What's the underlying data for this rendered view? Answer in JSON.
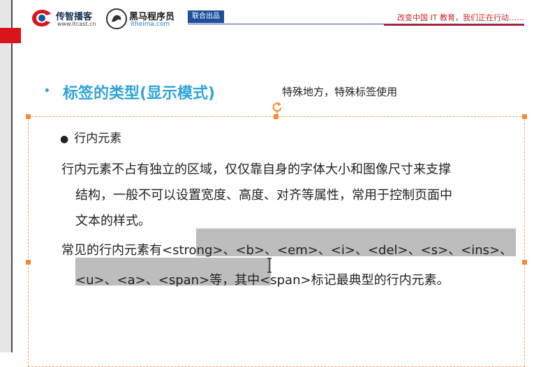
{
  "header": {
    "brand1": {
      "name": "传智播客",
      "url": "www.itcast.cn"
    },
    "brand2": {
      "name": "黑马程序员",
      "url": "itheima.com"
    },
    "joint_badge": "联合出品",
    "slogan": "改变中国 IT 教育，我们正在行动……"
  },
  "slide": {
    "title": "标签的类型(显示模式)",
    "subtitle": "特殊地方，特殊标签使用",
    "bullet": "行内元素",
    "paragraph1": {
      "line1": "行内元素不占有独立的区域，仅仅靠自身的字体大小和图像尺寸来支撑",
      "line2": "结构，一般不可以设置宽度、高度、对齐等属性，常用于控制页面中",
      "line3": "文本的样式。"
    },
    "paragraph2": {
      "line1": "常见的行内元素有<strong>、<b>、<em>、<i>、<del>、<s>、<ins>、",
      "line2": "<u>、<a>、<span>等，其中<span>标记最典型的行内元素。"
    }
  },
  "colors": {
    "accent_blue": "#2fa4d8",
    "brand_navy": "#1e4f9c",
    "brand_red": "#d9151b",
    "selection_handle": "#f48a35",
    "text_highlight": "#bdbdbd"
  },
  "icons": [
    "itcast-logo-icon",
    "itheima-logo-icon",
    "rotate-handle-icon",
    "text-cursor-icon",
    "bullet-disc-icon"
  ]
}
